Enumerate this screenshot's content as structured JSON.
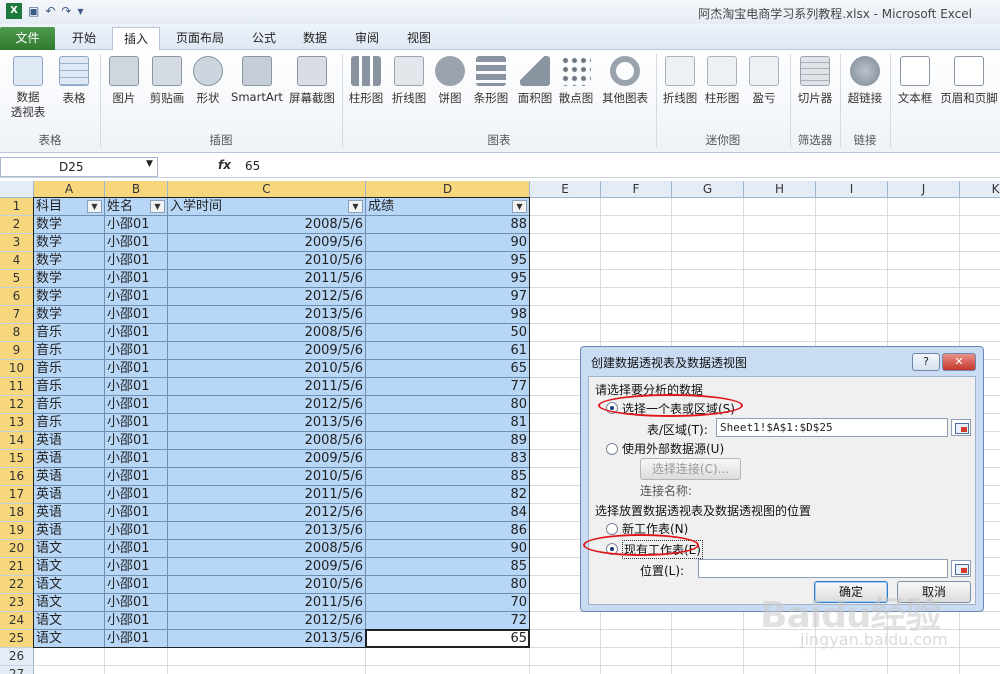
{
  "window": {
    "title": "阿杰淘宝电商学习系列教程.xlsx  -  Microsoft Excel"
  },
  "tabs": [
    {
      "label": "文件"
    },
    {
      "label": "开始"
    },
    {
      "label": "插入"
    },
    {
      "label": "页面布局"
    },
    {
      "label": "公式"
    },
    {
      "label": "数据"
    },
    {
      "label": "审阅"
    },
    {
      "label": "视图"
    }
  ],
  "ribbon": {
    "buttons": [
      "数据\n透视表",
      "表格",
      "图片",
      "剪贴画",
      "形状",
      "SmartArt",
      "屏幕截图",
      "柱形图",
      "折线图",
      "饼图",
      "条形图",
      "面积图",
      "散点图",
      "其他图表",
      "折线图",
      "柱形图",
      "盈亏",
      "切片器",
      "超链接",
      "文本框",
      "页眉和页脚"
    ],
    "groups": [
      "表格",
      "插图",
      "图表",
      "迷你图",
      "筛选器",
      "链接"
    ]
  },
  "formula_bar": {
    "name_box": "D25",
    "fx": "fx",
    "value": "65"
  },
  "columns": [
    "A",
    "B",
    "C",
    "D",
    "E",
    "F",
    "G",
    "H",
    "I",
    "J",
    "K"
  ],
  "table": {
    "headers": [
      "科目",
      "姓名",
      "入学时间",
      "成绩"
    ],
    "rows": [
      [
        "数学",
        "小邵01",
        "2008/5/6",
        "88"
      ],
      [
        "数学",
        "小邵01",
        "2009/5/6",
        "90"
      ],
      [
        "数学",
        "小邵01",
        "2010/5/6",
        "95"
      ],
      [
        "数学",
        "小邵01",
        "2011/5/6",
        "95"
      ],
      [
        "数学",
        "小邵01",
        "2012/5/6",
        "97"
      ],
      [
        "数学",
        "小邵01",
        "2013/5/6",
        "98"
      ],
      [
        "音乐",
        "小邵01",
        "2008/5/6",
        "50"
      ],
      [
        "音乐",
        "小邵01",
        "2009/5/6",
        "61"
      ],
      [
        "音乐",
        "小邵01",
        "2010/5/6",
        "65"
      ],
      [
        "音乐",
        "小邵01",
        "2011/5/6",
        "77"
      ],
      [
        "音乐",
        "小邵01",
        "2012/5/6",
        "80"
      ],
      [
        "音乐",
        "小邵01",
        "2013/5/6",
        "81"
      ],
      [
        "英语",
        "小邵01",
        "2008/5/6",
        "89"
      ],
      [
        "英语",
        "小邵01",
        "2009/5/6",
        "83"
      ],
      [
        "英语",
        "小邵01",
        "2010/5/6",
        "85"
      ],
      [
        "英语",
        "小邵01",
        "2011/5/6",
        "82"
      ],
      [
        "英语",
        "小邵01",
        "2012/5/6",
        "84"
      ],
      [
        "英语",
        "小邵01",
        "2013/5/6",
        "86"
      ],
      [
        "语文",
        "小邵01",
        "2008/5/6",
        "90"
      ],
      [
        "语文",
        "小邵01",
        "2009/5/6",
        "85"
      ],
      [
        "语文",
        "小邵01",
        "2010/5/6",
        "80"
      ],
      [
        "语文",
        "小邵01",
        "2011/5/6",
        "70"
      ],
      [
        "语文",
        "小邵01",
        "2012/5/6",
        "72"
      ],
      [
        "语文",
        "小邵01",
        "2013/5/6",
        "65"
      ]
    ],
    "extra_row_numbers": [
      "26",
      "27"
    ]
  },
  "dialog": {
    "title": "创建数据透视表及数据透视图",
    "help": "?",
    "close": "✕",
    "section1": "请选择要分析的数据",
    "opt_range": "选择一个表或区域(S)",
    "range_label": "表/区域(T):",
    "range_value": "Sheet1!$A$1:$D$25",
    "opt_external": "使用外部数据源(U)",
    "choose_conn": "选择连接(C)...",
    "conn_name": "连接名称:",
    "section2": "选择放置数据透视表及数据透视图的位置",
    "opt_new": "新工作表(N)",
    "opt_existing": "现有工作表(E)",
    "location_label": "位置(L):",
    "location_value": "",
    "ok": "确定",
    "cancel": "取消"
  },
  "watermark": {
    "brand": "Baidu经验",
    "url": "jingyan.baidu.com"
  }
}
